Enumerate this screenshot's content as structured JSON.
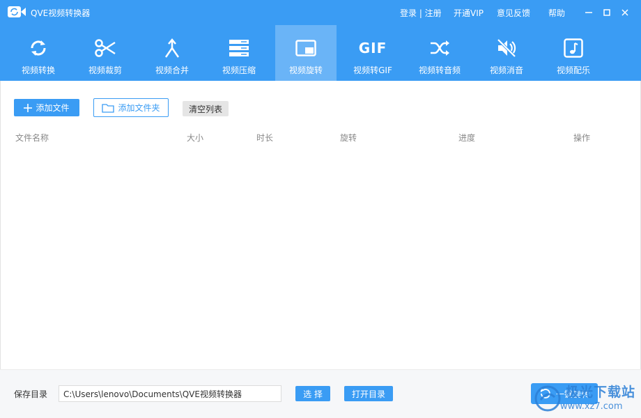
{
  "app": {
    "title": "QVE视频转换器"
  },
  "header": {
    "login": "登录 | 注册",
    "vip": "开通VIP",
    "feedback": "意见反馈",
    "help": "帮助"
  },
  "toolbar": {
    "items": [
      {
        "label": "视频转换",
        "icon": "refresh-icon"
      },
      {
        "label": "视频裁剪",
        "icon": "scissors-icon"
      },
      {
        "label": "视频合并",
        "icon": "merge-icon"
      },
      {
        "label": "视频压缩",
        "icon": "compress-icon"
      },
      {
        "label": "视频旋转",
        "icon": "rotate-screen-icon",
        "active": true
      },
      {
        "label": "视频转GIF",
        "icon": "gif-icon"
      },
      {
        "label": "视频转音频",
        "icon": "shuffle-icon"
      },
      {
        "label": "视频消音",
        "icon": "mute-icon"
      },
      {
        "label": "视频配乐",
        "icon": "music-icon"
      }
    ],
    "gif_text": "GIF"
  },
  "actions": {
    "add_file": "添加文件",
    "add_folder": "添加文件夹",
    "clear_list": "清空列表"
  },
  "table": {
    "columns": [
      "文件名称",
      "大小",
      "时长",
      "旋转",
      "进度",
      "操作"
    ]
  },
  "footer": {
    "save_label": "保存目录",
    "save_path": "C:\\Users\\lenovo\\Documents\\QVE视频转换器",
    "select_button": "选 择",
    "open_dir_button": "打开目录",
    "rotate_button": "一键旋转"
  },
  "watermark": {
    "line1": "极光下载站",
    "line2": "www.xz7.com"
  },
  "colors": {
    "accent": "#3a9cf4",
    "active_tab": "#6ab4f7"
  }
}
